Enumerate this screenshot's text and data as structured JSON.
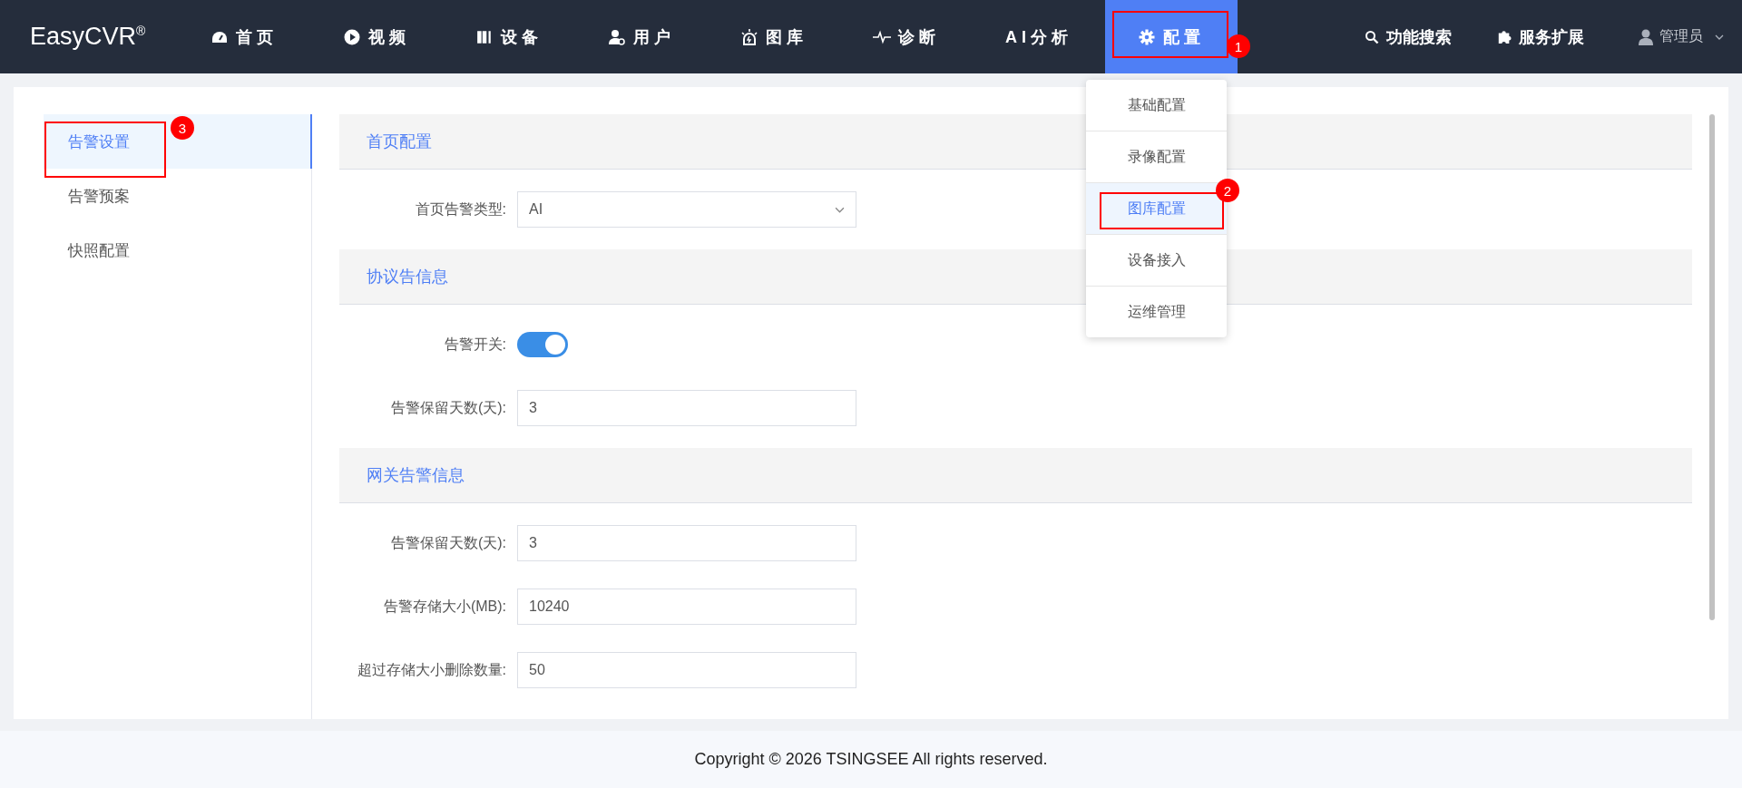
{
  "logo": {
    "text": "EasyCVR",
    "mark": "®"
  },
  "nav": {
    "items": [
      {
        "label": "首页",
        "selected": false
      },
      {
        "label": "视频",
        "selected": false
      },
      {
        "label": "设备",
        "selected": false
      },
      {
        "label": "用户",
        "selected": false
      },
      {
        "label": "图库",
        "selected": false
      },
      {
        "label": "诊断",
        "selected": false
      },
      {
        "label": "AI分析",
        "selected": false
      },
      {
        "label": "配置",
        "selected": true,
        "annotation": "1"
      }
    ],
    "right": [
      {
        "label": "功能搜索"
      },
      {
        "label": "服务扩展"
      }
    ],
    "user": {
      "name": "管理员"
    }
  },
  "dropdown": {
    "items": [
      {
        "label": "基础配置",
        "selected": false
      },
      {
        "label": "录像配置",
        "selected": false
      },
      {
        "label": "图库配置",
        "selected": true,
        "annotation": "2"
      },
      {
        "label": "设备接入",
        "selected": false
      },
      {
        "label": "运维管理",
        "selected": false
      }
    ]
  },
  "sidebar": {
    "items": [
      {
        "label": "告警设置",
        "selected": true,
        "annotation": "3"
      },
      {
        "label": "告警预案",
        "selected": false
      },
      {
        "label": "快照配置",
        "selected": false
      }
    ]
  },
  "sections": [
    {
      "title": "首页配置",
      "fields": [
        {
          "kind": "select",
          "label": "首页告警类型:",
          "value": "AI"
        }
      ]
    },
    {
      "title": "协议告信息",
      "fields": [
        {
          "kind": "switch",
          "label": "告警开关:",
          "on": true
        },
        {
          "kind": "input",
          "label": "告警保留天数(天):",
          "value": "3"
        }
      ]
    },
    {
      "title": "网关告警信息",
      "fields": [
        {
          "kind": "input",
          "label": "告警保留天数(天):",
          "value": "3"
        },
        {
          "kind": "input",
          "label": "告警存储大小(MB):",
          "value": "10240"
        },
        {
          "kind": "input",
          "label": "超过存储大小删除数量:",
          "value": "50"
        }
      ]
    }
  ],
  "footer": "Copyright © 2026 TSINGSEE All rights reserved."
}
